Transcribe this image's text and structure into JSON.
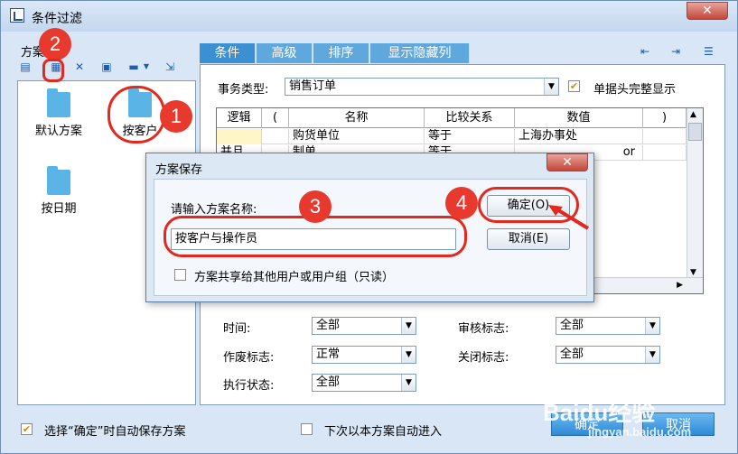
{
  "window": {
    "title": "条件过滤",
    "close_glyph": "✕"
  },
  "left": {
    "scheme_label": "方案",
    "toolbar_icons": [
      "save-icon",
      "save-as-icon",
      "delete-icon",
      "clear-icon",
      "menu-icon",
      "export-icon"
    ],
    "schemes": [
      {
        "label": "默认方案"
      },
      {
        "label": "按客户"
      },
      {
        "label": "按日期"
      }
    ]
  },
  "tabs": [
    {
      "label": "条件",
      "active": true
    },
    {
      "label": "高级",
      "active": false
    },
    {
      "label": "排序",
      "active": false
    },
    {
      "label": "显示隐藏列",
      "active": false
    }
  ],
  "filter": {
    "business_type_label": "事务类型:",
    "business_type_value": "销售订单",
    "full_header_label": "单据头完整显示",
    "full_header_checked": true
  },
  "grid": {
    "columns": [
      "逻辑",
      "(",
      "名称",
      "比较关系",
      "数值",
      ")"
    ],
    "rows": [
      {
        "logic": "",
        "lparen": "",
        "name": "购货单位",
        "relation": "等于",
        "value": "上海办事处",
        "rparen": ""
      },
      {
        "logic": "并且",
        "lparen": "",
        "name": "制单",
        "relation": "等于",
        "value": "or",
        "rparen": ""
      }
    ]
  },
  "fields": {
    "time_label": "时间:",
    "time_value": "全部",
    "audit_label": "审核标志:",
    "audit_value": "全部",
    "void_label": "作废标志:",
    "void_value": "正常",
    "close_label": "关闭标志:",
    "close_value": "全部",
    "exec_label": "执行状态:",
    "exec_value": "全部"
  },
  "dialog": {
    "title": "方案保存",
    "close_glyph": "✕",
    "prompt": "请输入方案名称:",
    "name_value": "按客户与操作员",
    "ok_label": "确定(O)",
    "cancel_label": "取消(E)",
    "share_label": "方案共享给其他用户或用户组（只读）",
    "share_checked": false
  },
  "bottom": {
    "auto_save_label": "选择“确定”时自动保存方案",
    "auto_save_checked": true,
    "auto_enter_label": "下次以本方案自动进入",
    "auto_enter_checked": false,
    "ok_label": "确定",
    "cancel_label": "取消"
  },
  "annotations": [
    "1",
    "2",
    "3",
    "4"
  ],
  "watermark": {
    "brand": "Baidu经验",
    "url": "jingyan.baidu.com"
  },
  "colors": {
    "accent": "#3b8fd3",
    "annotation": "#e3281e",
    "check": "#d08a00"
  }
}
